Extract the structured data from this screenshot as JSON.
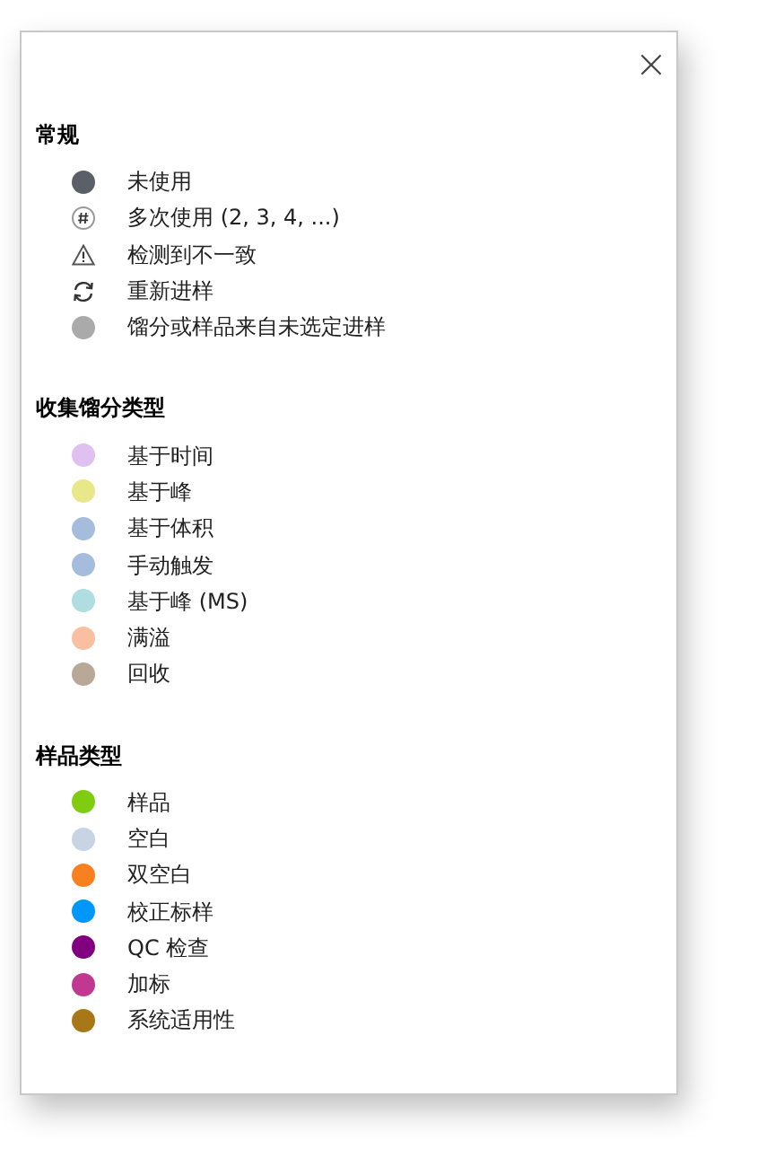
{
  "close_button": {
    "label": "×"
  },
  "sections": [
    {
      "title": "常规",
      "items": [
        {
          "kind": "dot",
          "color": "#5b6068",
          "label": "未使用"
        },
        {
          "kind": "hash",
          "label": "多次使用 (2, 3, 4, ...)"
        },
        {
          "kind": "warning",
          "label": "检测到不一致"
        },
        {
          "kind": "refresh",
          "label": "重新进样"
        },
        {
          "kind": "dot",
          "color": "#aaaaaa",
          "label": "馏分或样品来自未选定进样"
        }
      ]
    },
    {
      "title": "收集馏分类型",
      "items": [
        {
          "kind": "dot",
          "color": "#e0c0f0",
          "label": "基于时间"
        },
        {
          "kind": "dot",
          "color": "#e8e88a",
          "label": "基于峰"
        },
        {
          "kind": "dot",
          "color": "#a6bcdc",
          "label": "基于体积"
        },
        {
          "kind": "dot",
          "color": "#a6bcdc",
          "label": "手动触发"
        },
        {
          "kind": "dot",
          "color": "#b0dde0",
          "label": "基于峰 (MS)"
        },
        {
          "kind": "dot",
          "color": "#f8c0a0",
          "label": "满溢"
        },
        {
          "kind": "dot",
          "color": "#b8a898",
          "label": "回收"
        }
      ]
    },
    {
      "title": "样品类型",
      "items": [
        {
          "kind": "dot",
          "color": "#80cc10",
          "label": "样品"
        },
        {
          "kind": "dot",
          "color": "#c8d4e4",
          "label": "空白"
        },
        {
          "kind": "dot",
          "color": "#f88020",
          "label": "双空白"
        },
        {
          "kind": "dot",
          "color": "#0098f8",
          "label": "校正标样"
        },
        {
          "kind": "dot",
          "color": "#800080",
          "label": "QC 检查"
        },
        {
          "kind": "dot",
          "color": "#c03890",
          "label": "加标"
        },
        {
          "kind": "dot",
          "color": "#a87818",
          "label": "系统适用性"
        }
      ]
    }
  ]
}
